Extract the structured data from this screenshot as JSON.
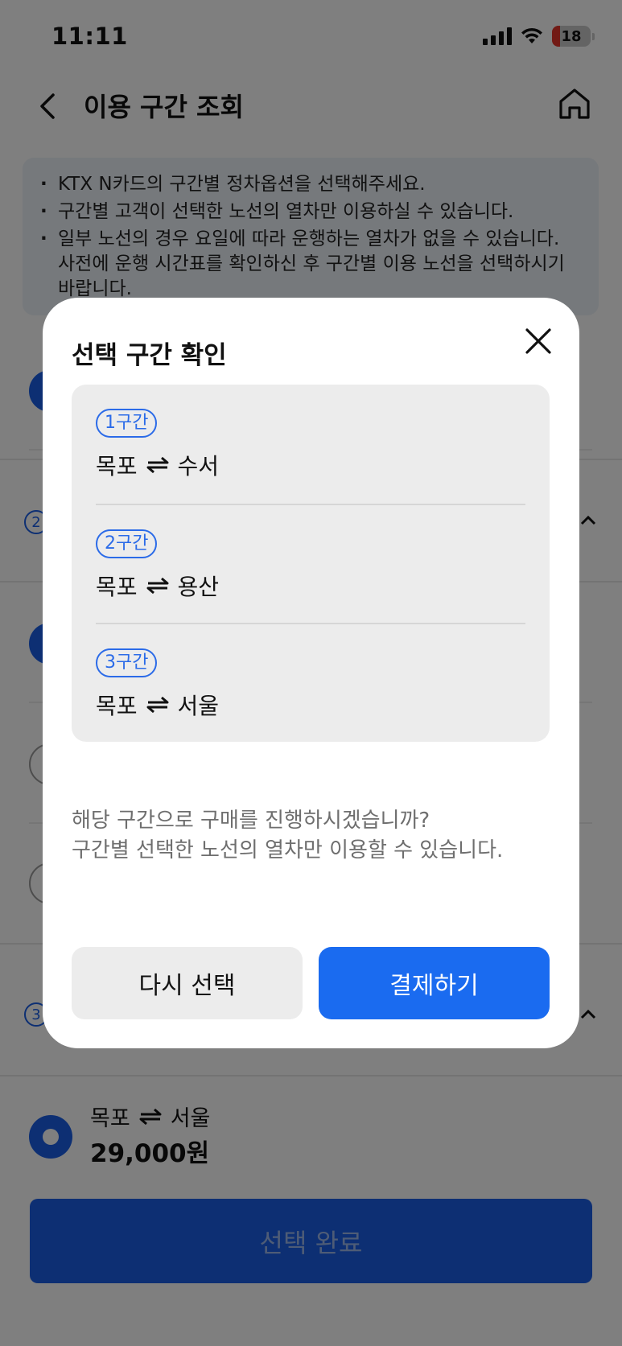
{
  "status_bar": {
    "time": "11:11",
    "battery": "18"
  },
  "header": {
    "title": "이용 구간 조회"
  },
  "notice": {
    "items": [
      "KTX N카드의 구간별 정차옵션을 선택해주세요.",
      "구간별 고객이 선택한 노선의 열차만 이용하실 수 있습니다.",
      "일부 노선의 경우 요일에 따라 운행하는 열차가 없을 수 있습니다. 사전에 운행 시간표를 확인하신 후 구간별 이용 노선을 선택하시기 바랍니다."
    ]
  },
  "background_sections": {
    "badge_2": "2",
    "badge_3": "3"
  },
  "summary": {
    "from": "목포",
    "to": "서울",
    "price": "29,000원"
  },
  "complete_button": "선택 완료",
  "modal": {
    "title": "선택 구간 확인",
    "routes": [
      {
        "badge": "1구간",
        "from": "목포",
        "to": "수서"
      },
      {
        "badge": "2구간",
        "from": "목포",
        "to": "용산"
      },
      {
        "badge": "3구간",
        "from": "목포",
        "to": "서울"
      }
    ],
    "confirm_line1": "해당 구간으로 구매를 진행하시겠습니까?",
    "confirm_line2": "구간별 선택한 노선의 열차만 이용할 수 있습니다.",
    "reselect_label": "다시 선택",
    "pay_label": "결제하기"
  },
  "icons": {
    "back": "chevron-left-icon",
    "home": "home-icon",
    "close": "close-icon",
    "swap": "swap-arrows-icon"
  },
  "colors": {
    "primary": "#1a6bf0",
    "badge_blue": "#2b6be8",
    "overlay": "rgba(0,0,0,0.5)"
  }
}
